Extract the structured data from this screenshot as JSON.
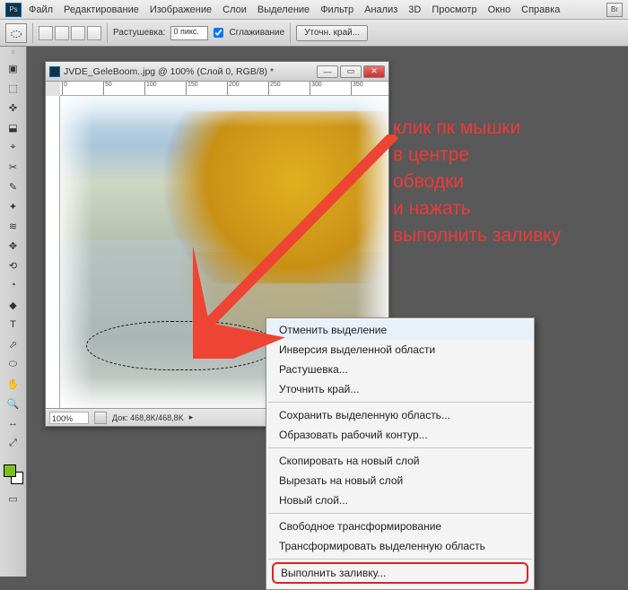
{
  "app_badge": "Ps",
  "menu": [
    "Файл",
    "Редактирование",
    "Изображение",
    "Слои",
    "Выделение",
    "Фильтр",
    "Анализ",
    "3D",
    "Просмотр",
    "Окно",
    "Справка"
  ],
  "mb_icon": "Br",
  "options": {
    "feather_label": "Растушевка:",
    "feather_value": "0 пикс.",
    "antialias_label": "Сглаживание",
    "refine_btn": "Уточн. край..."
  },
  "document": {
    "title": "JVDE_GeleBoom..jpg @ 100% (Слой 0, RGB/8) *",
    "ruler_marks": [
      "0",
      "50",
      "100",
      "150",
      "200",
      "250",
      "300",
      "350"
    ],
    "status_zoom": "100%",
    "status_docsize": "Док: 468,8K/468,8K"
  },
  "context_menu": {
    "items": [
      "Отменить выделение",
      "Инверсия выделенной области",
      "Растушевка...",
      "Уточнить край...",
      "Сохранить выделенную область...",
      "Образовать рабочий контур...",
      "Скопировать на новый слой",
      "Вырезать на новый слой",
      "Новый слой...",
      "Свободное трансформирование",
      "Трансформировать выделенную область",
      "Выполнить заливку..."
    ]
  },
  "annotation": {
    "l1": "клик пк мышки",
    "l2": "в центре",
    "l3": "обводки",
    "l4": "и нажать",
    "l5": "выполнить заливку"
  },
  "tool_glyphs": [
    "▣",
    "⬚",
    "✜",
    "⬓",
    "⌖",
    "✂",
    "✎",
    "✦",
    "≋",
    "✥",
    "⟲",
    "◔",
    "◆",
    "T",
    "⬀",
    "⬭",
    "✋",
    "🔍",
    "↔",
    "⤢"
  ]
}
